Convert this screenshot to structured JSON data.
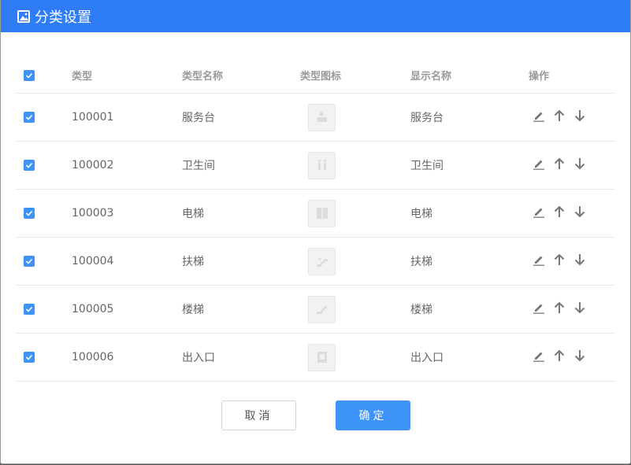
{
  "dialog": {
    "title": "分类设置"
  },
  "table": {
    "headers": {
      "type": "类型",
      "type_name": "类型名称",
      "type_icon": "类型图标",
      "display_name": "显示名称",
      "actions": "操作"
    },
    "rows": [
      {
        "type": "100001",
        "type_name": "服务台",
        "icon": "service-desk-icon",
        "display_name": "服务台",
        "checked": true
      },
      {
        "type": "100002",
        "type_name": "卫生间",
        "icon": "restroom-icon",
        "display_name": "卫生间",
        "checked": true
      },
      {
        "type": "100003",
        "type_name": "电梯",
        "icon": "elevator-icon",
        "display_name": "电梯",
        "checked": true
      },
      {
        "type": "100004",
        "type_name": "扶梯",
        "icon": "escalator-icon",
        "display_name": "扶梯",
        "checked": true
      },
      {
        "type": "100005",
        "type_name": "楼梯",
        "icon": "stairs-icon",
        "display_name": "楼梯",
        "checked": true
      },
      {
        "type": "100006",
        "type_name": "出入口",
        "icon": "entrance-icon",
        "display_name": "出入口",
        "checked": true
      }
    ]
  },
  "buttons": {
    "cancel": "取消",
    "confirm": "确定"
  },
  "colors": {
    "title_bar": "#2e7cf6",
    "accent": "#3d93f7"
  }
}
